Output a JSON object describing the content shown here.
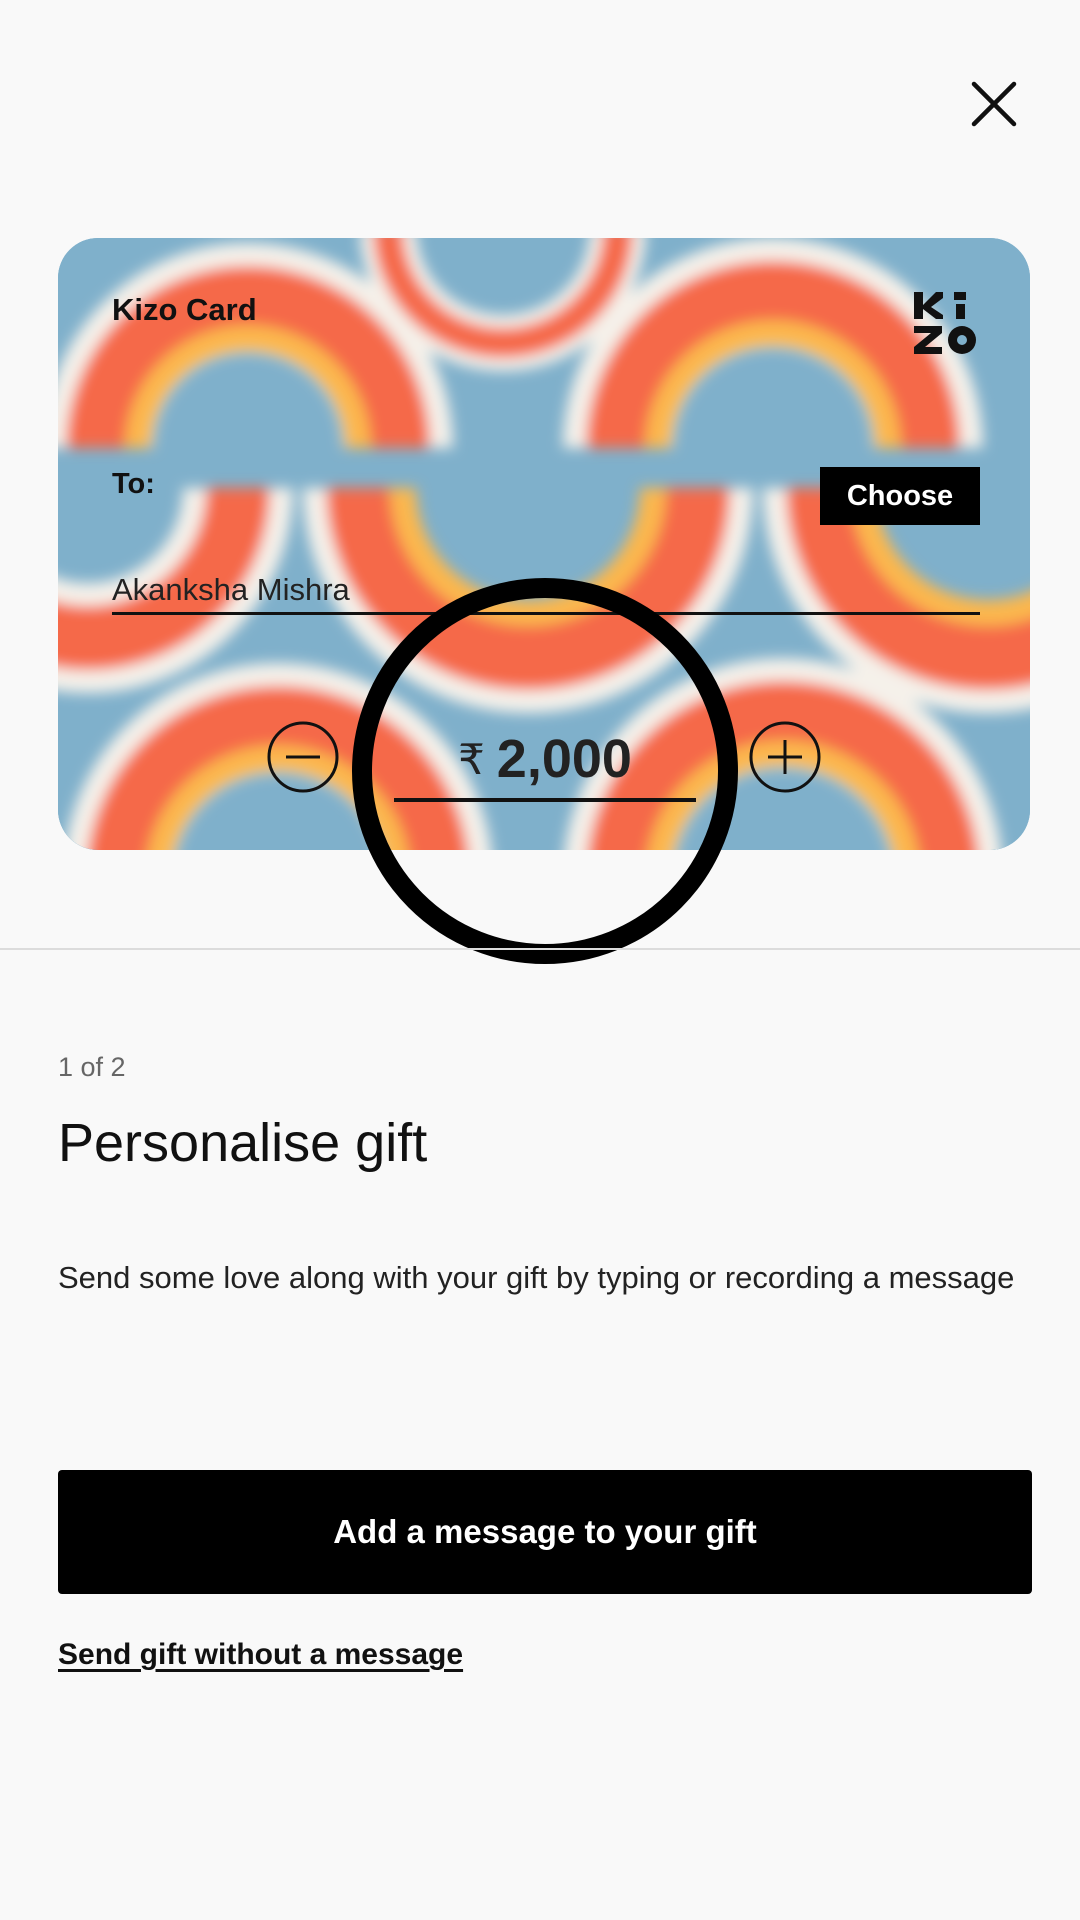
{
  "header": {
    "close_icon": "close-icon"
  },
  "card": {
    "title": "Kizo Card",
    "logo_icon": "kizo-logo-icon",
    "to_label": "To:",
    "choose_label": "Choose",
    "recipient_name": "Akanksha Mishra",
    "currency_symbol": "₹",
    "amount": "2,000",
    "decrement_icon": "minus-circle-icon",
    "increment_icon": "plus-circle-icon",
    "background_colors": {
      "base": "#7fb0cb",
      "arc_outer": "#f5694a",
      "arc_inner": "#fbb74d"
    }
  },
  "step": {
    "indicator": "1 of 2",
    "title": "Personalise gift",
    "description": "Send some love along with your gift by typing or recording a message"
  },
  "actions": {
    "primary_label": "Add a message to your gift",
    "secondary_label": "Send gift without a message"
  },
  "colors": {
    "background": "#f9f9f9",
    "primary_button": "#000000",
    "primary_button_text": "#ffffff"
  }
}
